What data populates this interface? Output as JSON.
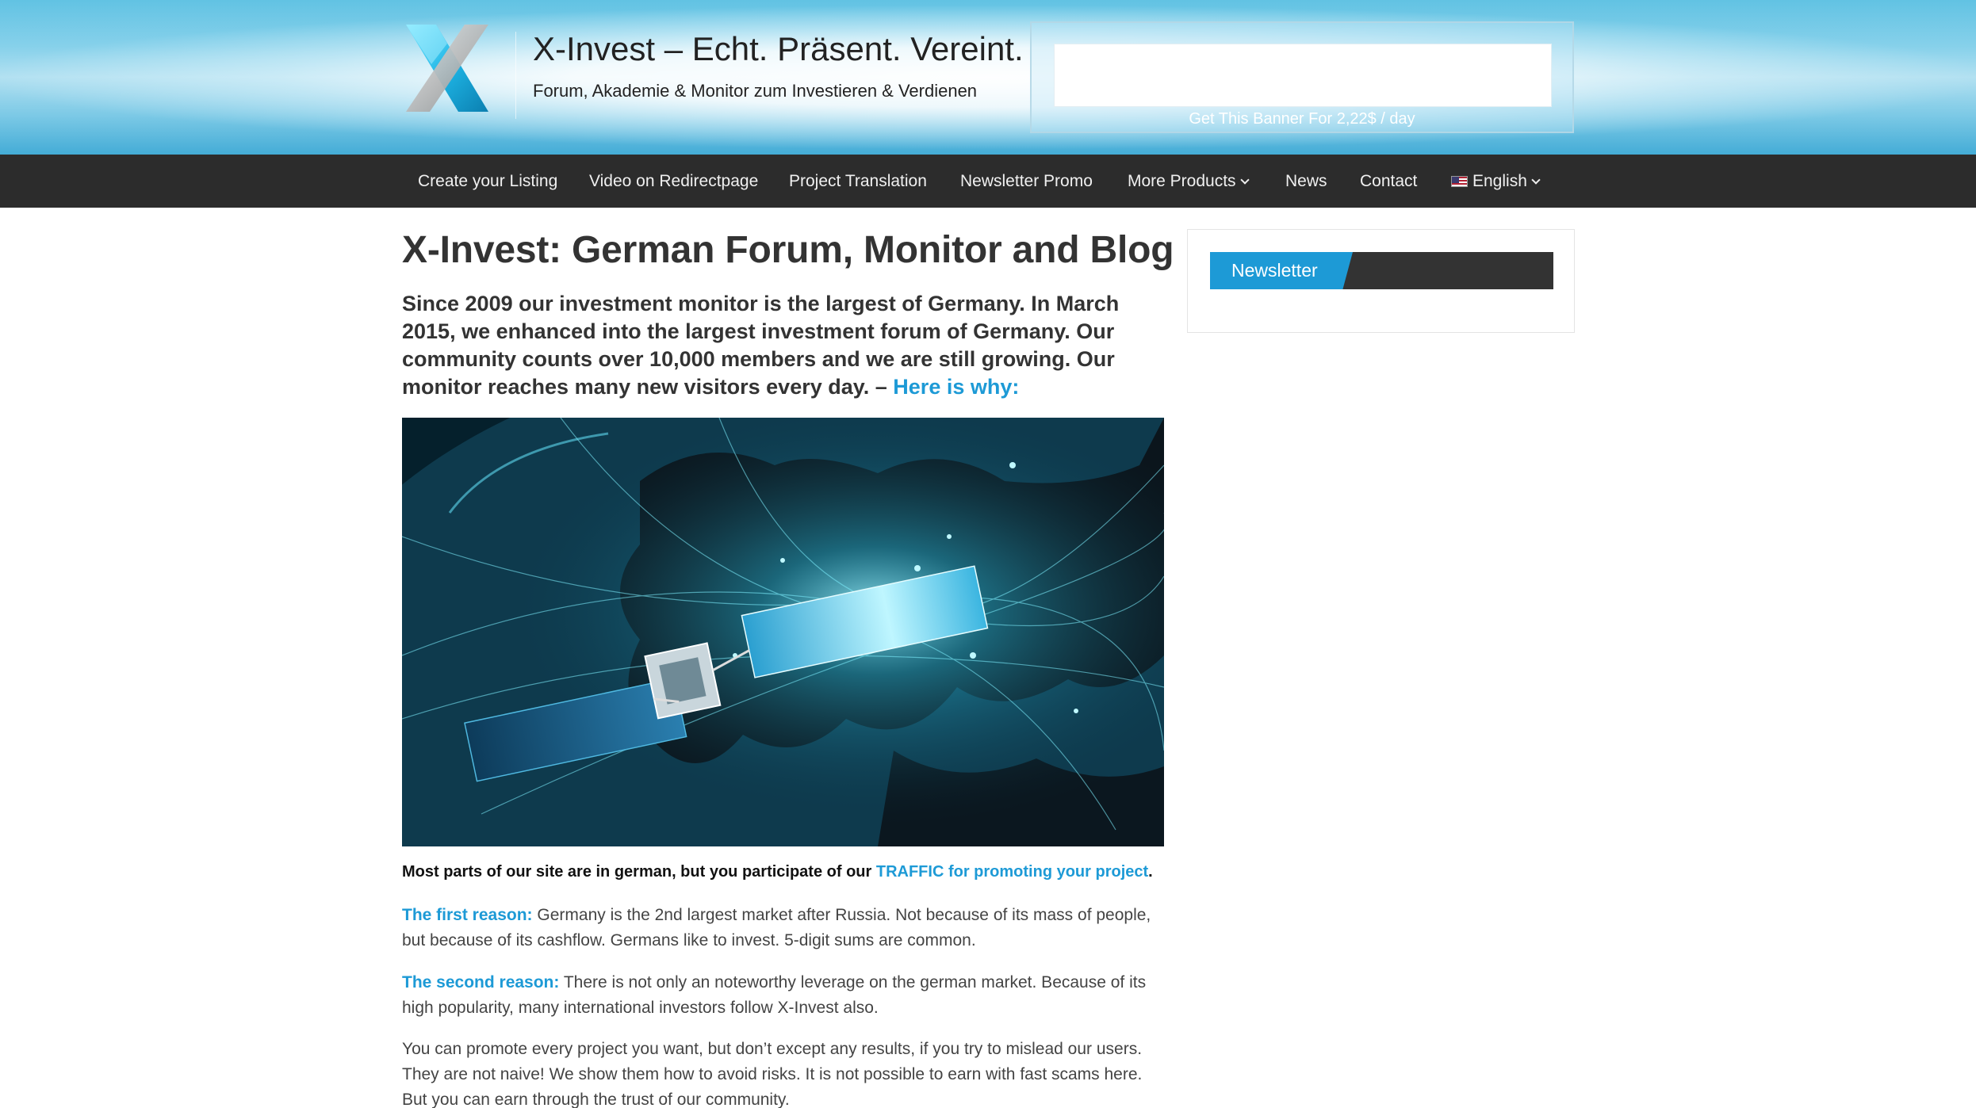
{
  "header": {
    "site_title": "X-Invest – Echt. Präsent. Vereint.",
    "tagline": "Forum, Akademie & Monitor zum Investieren & Verdienen",
    "banner_caption": "Get This Banner For 2,22$ / day",
    "logo_icon": "x-logo-icon"
  },
  "nav": {
    "items": [
      {
        "label": "Create your Listing"
      },
      {
        "label": "Video on Redirectpage"
      },
      {
        "label": "Project Translation"
      },
      {
        "label": "Newsletter Promo"
      },
      {
        "label": "More Products"
      },
      {
        "label": "News"
      },
      {
        "label": "Contact"
      },
      {
        "label": "English"
      }
    ]
  },
  "main": {
    "heading": "X-Invest: German Forum, Monitor and Blog",
    "intro_text": "Since 2009 our investment monitor is the largest of Germany. In March 2015, we enhanced into the largest investment forum of Germany. Our community counts over 10,000 members and we are still growing. Our monitor reaches many new visitors every day. –",
    "intro_link": "Here is why:",
    "bold_text": "Most parts of our site are in german, but you participate of our",
    "bold_link": "TRAFFIC for promoting your project",
    "bold_end": ".",
    "reason1_lead": "The first reason:",
    "reason1_text": "Germany is the 2nd largest market after Russia. Not because of its mass of people, but because of its cashflow. Germans like to invest. 5-digit sums are common.",
    "reason2_lead": "The second reason:",
    "reason2_text": "There is not only an noteworthy leverage on the german market. Because of its high popularity, many international investors follow X-Invest also.",
    "para3": "You can promote every project you want, but don’t except any results, if you try to mislead our users. They are not naive! We show them how to avoid risks. It is not possible to earn with fast scams here. But you can earn through the trust of our community."
  },
  "sidebar": {
    "widget_title": "Newsletter"
  },
  "colors": {
    "accent": "#1d9ad6",
    "nav_bg": "#2c2c2c",
    "text": "#333333"
  }
}
